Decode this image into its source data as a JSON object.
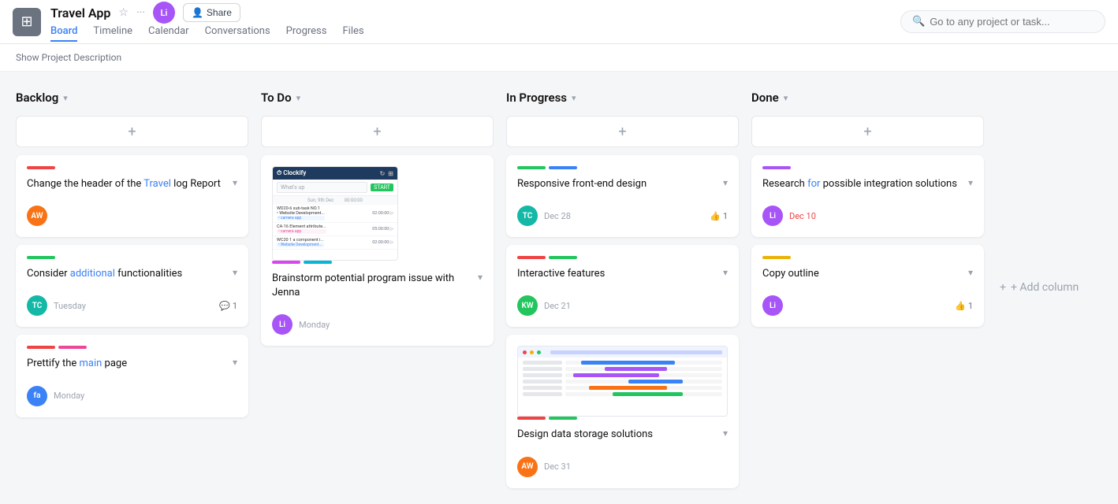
{
  "app": {
    "icon": "⊞",
    "title": "Travel App",
    "avatar_initials": "Li",
    "share_label": "Share"
  },
  "nav": {
    "tabs": [
      "Board",
      "Timeline",
      "Calendar",
      "Conversations",
      "Progress",
      "Files"
    ],
    "active_tab": "Board"
  },
  "search": {
    "placeholder": "Go to any project or task..."
  },
  "sub_header": {
    "label": "Show Project Description"
  },
  "add_column": {
    "label": "+ Add column"
  },
  "columns": [
    {
      "id": "backlog",
      "title": "Backlog",
      "cards": [
        {
          "id": "card-1",
          "bars": [
            "red"
          ],
          "title": "Change the header of the Travel log Report",
          "title_link_word": "Travel",
          "avatar_initials": "AW",
          "avatar_color": "avatar-orange",
          "date": "",
          "date_class": "",
          "likes": "",
          "comments": ""
        },
        {
          "id": "card-2",
          "bars": [
            "green"
          ],
          "title": "Consider additional functionalities",
          "title_link_word": "additional",
          "avatar_initials": "TC",
          "avatar_color": "avatar-teal",
          "date": "Tuesday",
          "date_class": "",
          "likes": "",
          "comments": "1"
        },
        {
          "id": "card-3",
          "bars": [
            "red",
            "pink"
          ],
          "title": "Prettify the main page",
          "title_link_word": "main",
          "avatar_initials": "fa",
          "avatar_color": "avatar-blue",
          "date": "Monday",
          "date_class": "",
          "likes": "",
          "comments": ""
        }
      ]
    },
    {
      "id": "todo",
      "title": "To Do",
      "cards": [
        {
          "id": "card-4",
          "type": "image-clockify",
          "bars": [],
          "title": "Brainstorm potential program issue with Jenna",
          "title_link_word": "",
          "avatar_initials": "Li",
          "avatar_color": "avatar-purple",
          "date": "Monday",
          "date_class": "",
          "likes": "",
          "comments": ""
        }
      ]
    },
    {
      "id": "inprogress",
      "title": "In Progress",
      "cards": [
        {
          "id": "card-5",
          "bars": [
            "green",
            "blue"
          ],
          "title": "Responsive front-end design",
          "title_link_word": "",
          "avatar_initials": "TC",
          "avatar_color": "avatar-teal",
          "date": "Dec 28",
          "date_class": "",
          "likes": "1",
          "comments": ""
        },
        {
          "id": "card-6",
          "bars": [
            "red",
            "green"
          ],
          "title": "Interactive features",
          "title_link_word": "",
          "avatar_initials": "KW",
          "avatar_color": "avatar-green",
          "date": "Dec 21",
          "date_class": "",
          "likes": "",
          "comments": ""
        },
        {
          "id": "card-7",
          "type": "image-gantt",
          "bars": [
            "red",
            "green"
          ],
          "title": "Design data storage solutions",
          "title_link_word": "",
          "avatar_initials": "AW",
          "avatar_color": "avatar-orange",
          "date": "Dec 31",
          "date_class": "",
          "likes": "",
          "comments": ""
        }
      ]
    },
    {
      "id": "done",
      "title": "Done",
      "cards": [
        {
          "id": "card-8",
          "bars": [
            "purple"
          ],
          "title": "Research for possible integration solutions",
          "title_link_word": "for",
          "avatar_initials": "Li",
          "avatar_color": "avatar-purple",
          "date": "Dec 10",
          "date_class": "red",
          "likes": "",
          "comments": ""
        },
        {
          "id": "card-9",
          "bars": [
            "yellow"
          ],
          "title": "Copy outline",
          "title_link_word": "",
          "avatar_initials": "Li",
          "avatar_color": "avatar-purple",
          "date": "",
          "date_class": "",
          "likes": "1",
          "comments": ""
        }
      ]
    }
  ]
}
